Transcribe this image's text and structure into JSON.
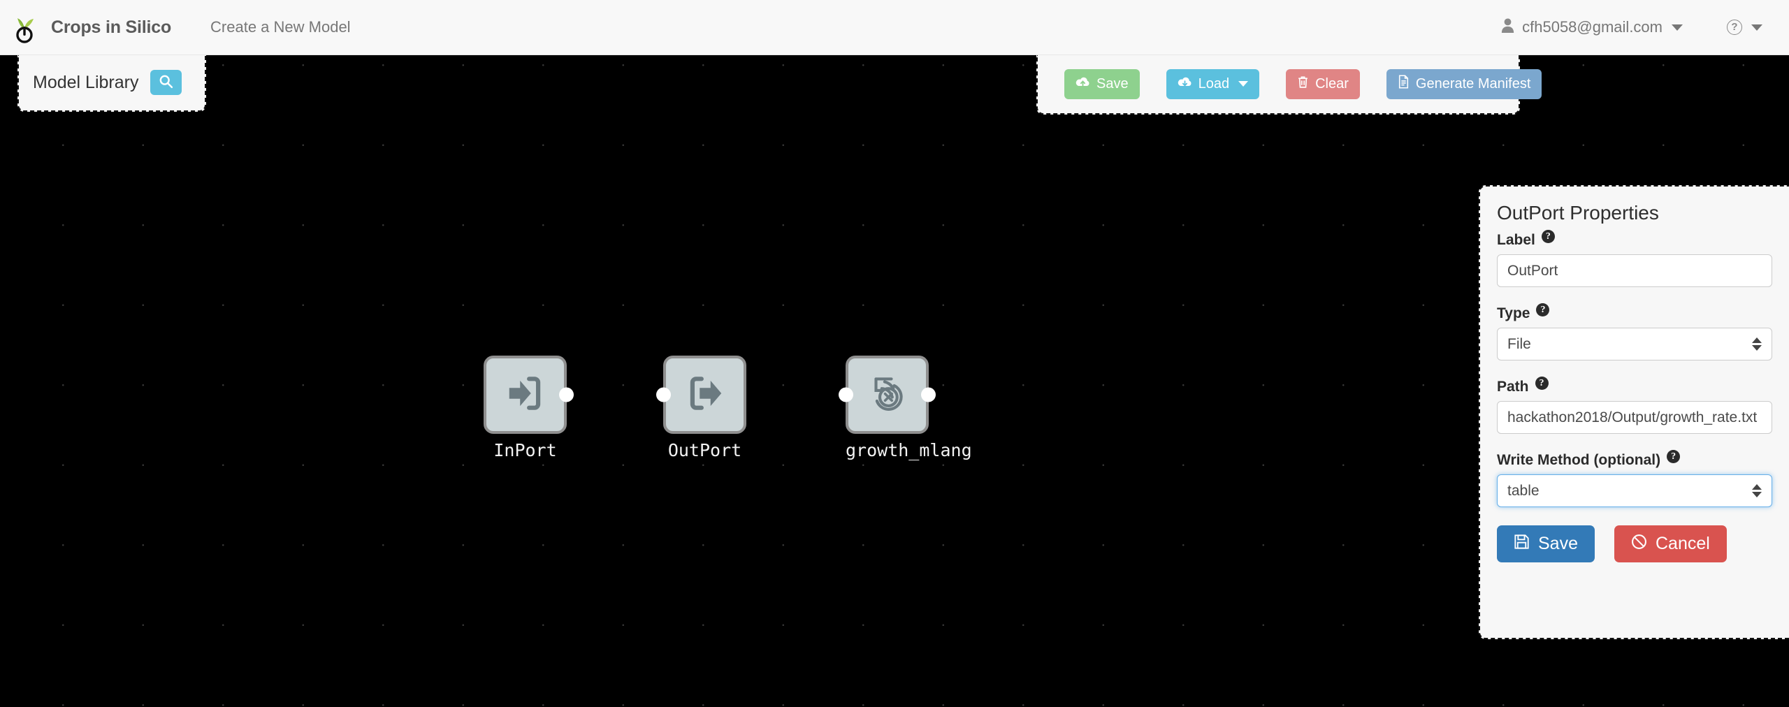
{
  "header": {
    "logo_icon": "sprout-power-logo",
    "brand": "Crops in Silico",
    "nav_link": "Create a New Model",
    "user_email": "cfh5058@gmail.com",
    "user_icon": "user-icon",
    "help_icon": "question-circle-icon"
  },
  "model_library": {
    "title": "Model Library",
    "search_icon": "search-icon"
  },
  "toolbar": {
    "buttons": [
      {
        "label": "Save",
        "icon": "cloud-upload-icon",
        "color": "#8ed18e"
      },
      {
        "label": "Load",
        "icon": "cloud-download-icon",
        "color": "#5bc0de",
        "has_caret": true
      },
      {
        "label": "Clear",
        "icon": "trash-icon",
        "color": "#e08585"
      },
      {
        "label": "Generate Manifest",
        "icon": "file-icon",
        "color": "#7ba7ce"
      }
    ]
  },
  "canvas": {
    "background_color": "#000000",
    "nodes": [
      {
        "label": "InPort",
        "icon": "sign-in-icon",
        "ports": [
          "right"
        ]
      },
      {
        "label": "OutPort",
        "icon": "sign-out-icon",
        "ports": [
          "left"
        ]
      },
      {
        "label": "growth_mlang",
        "icon": "mlang-icon",
        "ports": [
          "left",
          "right"
        ]
      }
    ]
  },
  "properties": {
    "title": "OutPort Properties",
    "help_glyph": "?",
    "fields": [
      {
        "label": "Label",
        "value": "OutPort",
        "kind": "text"
      },
      {
        "label": "Type",
        "value": "File",
        "kind": "select"
      },
      {
        "label": "Path",
        "value": "hackathon2018/Output/growth_rate.txt",
        "kind": "text"
      },
      {
        "label": "Write Method (optional)",
        "value": "table",
        "kind": "select",
        "focused": true
      }
    ],
    "save_label": "Save",
    "cancel_label": "Cancel",
    "save_icon": "floppy-disk-icon",
    "cancel_icon": "ban-icon",
    "save_color": "#337ab7",
    "cancel_color": "#d9534f"
  }
}
